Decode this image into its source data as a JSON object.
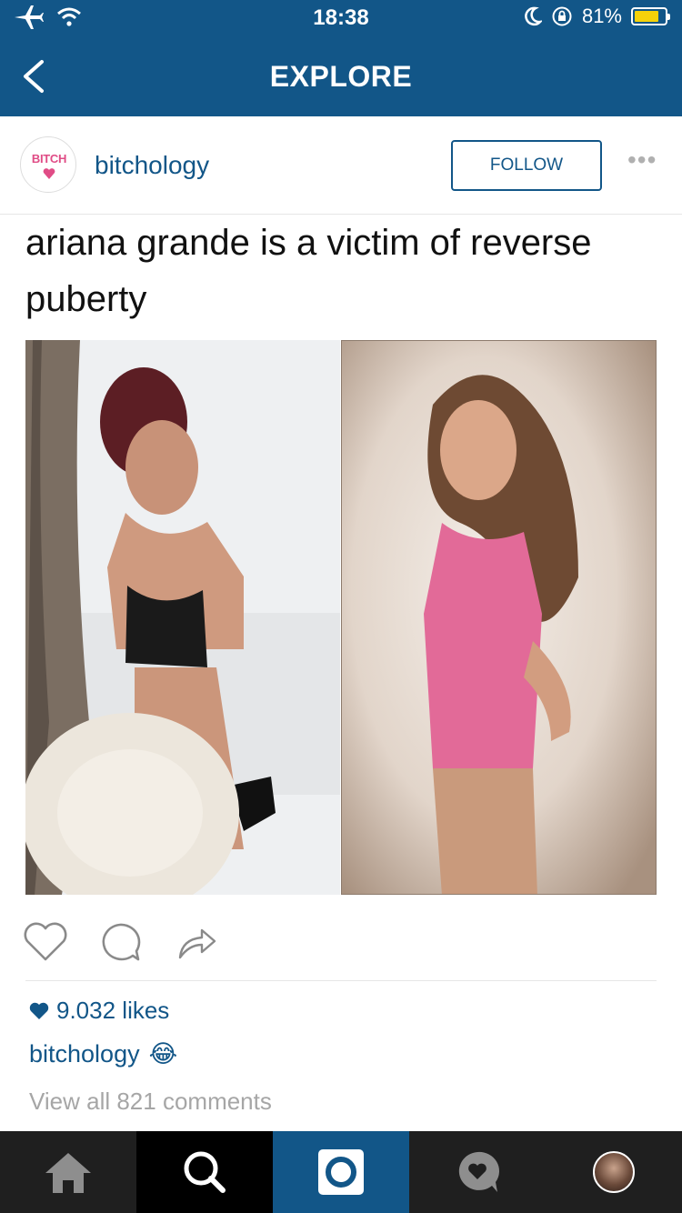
{
  "status_bar": {
    "time": "18:38",
    "battery_percent": "81%",
    "battery_level": 0.81,
    "left_icons": [
      "airplane-icon",
      "wifi-icon"
    ],
    "right_icons": [
      "moon-icon",
      "rotation-lock-icon"
    ]
  },
  "nav": {
    "title": "EXPLORE",
    "back_icon": "chevron-left-icon"
  },
  "post": {
    "avatar_text": "BITCH",
    "username": "bitchology",
    "follow_label": "FOLLOW",
    "more_label": "•••",
    "caption": "ariana grande is a victim of reverse puberty",
    "likes": "9.032 likes",
    "owner": "bitchology",
    "owner_emoji": "😂",
    "view_comments": "View all 821 comments"
  },
  "actions": [
    "heart-icon",
    "comment-icon",
    "share-icon"
  ],
  "tabbar": {
    "tabs": [
      "home-icon",
      "search-icon",
      "camera-icon",
      "activity-icon",
      "profile-avatar"
    ],
    "active_index": 2
  },
  "colors": {
    "brand": "#125688",
    "accent_yellow": "#f5d20a",
    "tab_bg": "#1f1f1f"
  }
}
